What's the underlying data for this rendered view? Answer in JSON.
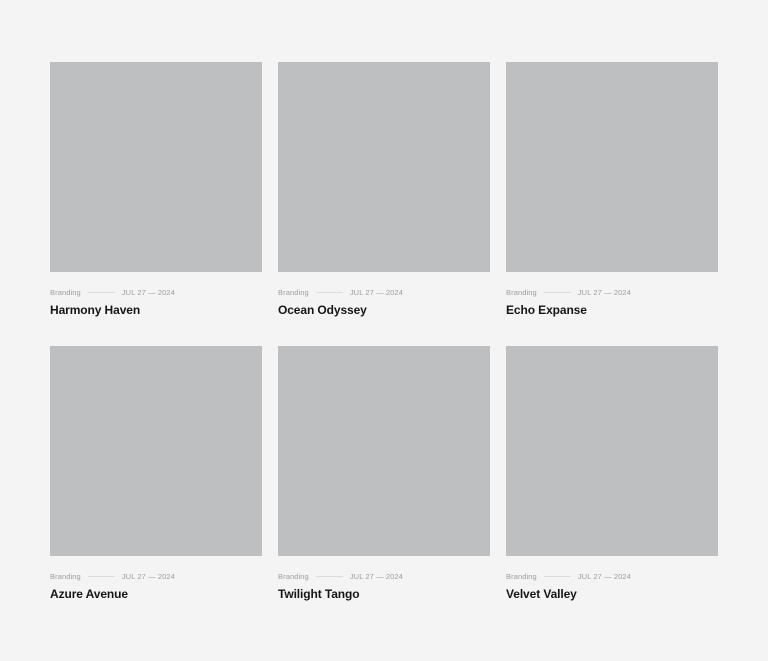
{
  "projects": [
    {
      "category": "Branding",
      "date": "JUL 27 — 2024",
      "title": "Harmony Haven"
    },
    {
      "category": "Branding",
      "date": "JUL 27 — 2024",
      "title": "Ocean Odyssey"
    },
    {
      "category": "Branding",
      "date": "JUL 27 — 2024",
      "title": "Echo Expanse"
    },
    {
      "category": "Branding",
      "date": "JUL 27 — 2024",
      "title": "Azure Avenue"
    },
    {
      "category": "Branding",
      "date": "JUL 27 — 2024",
      "title": "Twilight Tango"
    },
    {
      "category": "Branding",
      "date": "JUL 27 — 2024",
      "title": "Velvet Valley"
    }
  ]
}
